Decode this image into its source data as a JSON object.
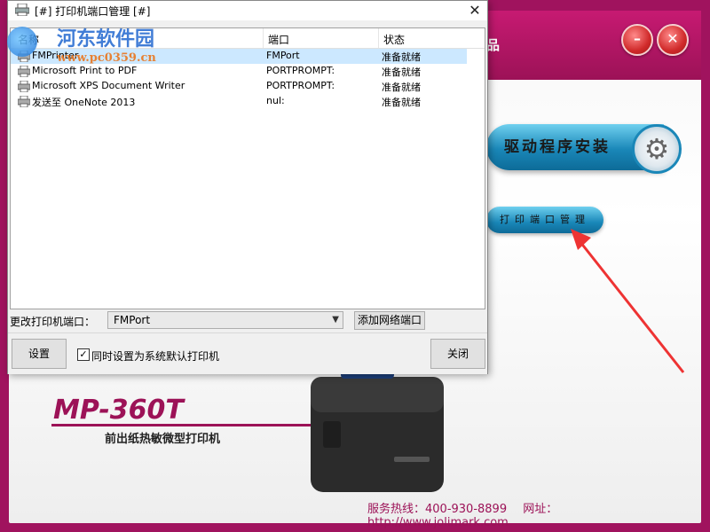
{
  "background": {
    "title_fragment": "品",
    "driver_install_label": "驱动程序安装",
    "port_manager_label": "打印端口管理",
    "model_name": "MP-360T",
    "model_desc": "前出纸热敏微型打印机",
    "footer_hotline": "服务热线：400-930-8899",
    "footer_website": "网址：http://www.jolimark.com",
    "accent_color": "#a0135e"
  },
  "dialog": {
    "title": "[#] 打印机端口管理 [#]",
    "close_glyph": "✕",
    "columns": [
      "名称",
      "端口",
      "状态"
    ],
    "rows": [
      {
        "name": "FMPrinter",
        "port": "FMPort",
        "status": "准备就绪",
        "selected": true
      },
      {
        "name": "Microsoft Print to PDF",
        "port": "PORTPROMPT:",
        "status": "准备就绪",
        "selected": false
      },
      {
        "name": "Microsoft XPS Document Writer",
        "port": "PORTPROMPT:",
        "status": "准备就绪",
        "selected": false
      },
      {
        "name": "发送至 OneNote 2013",
        "port": "nul:",
        "status": "准备就绪",
        "selected": false
      }
    ],
    "change_port_label": "更改打印机端口：",
    "port_select_value": "FMPort",
    "add_network_port_label": "添加网络端口",
    "settings_label": "设置",
    "default_printer_checkbox_label": "同时设置为系统默认打印机",
    "default_printer_checked": true,
    "close_label": "关闭"
  },
  "watermark": {
    "title": "河东软件园",
    "url": "www.pc0359.cn"
  }
}
